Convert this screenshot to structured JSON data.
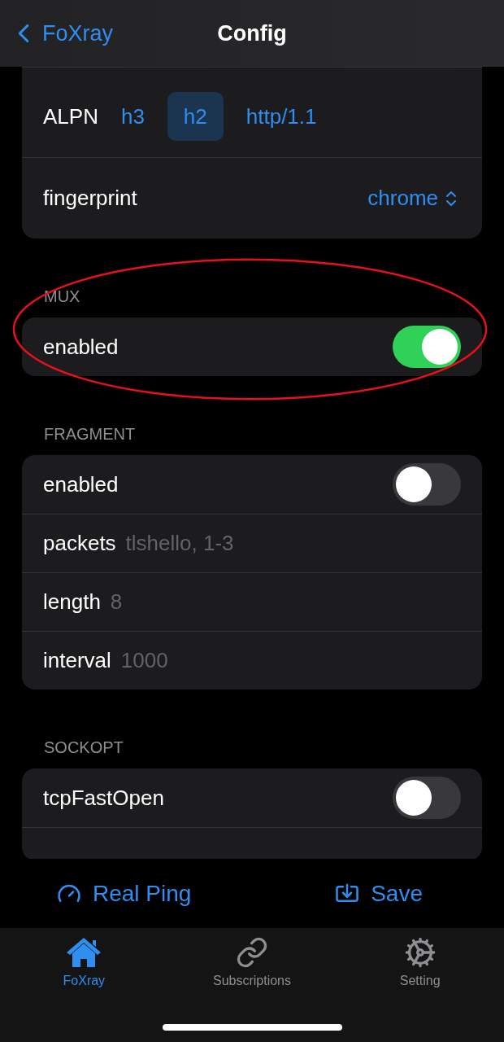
{
  "nav": {
    "back_label": "FoXray",
    "title": "Config"
  },
  "sections": [
    {
      "rows": [
        {
          "kind": "segmented",
          "label": "ALPN",
          "options": [
            {
              "label": "h3",
              "selected": false
            },
            {
              "label": "h2",
              "selected": true
            },
            {
              "label": "http/1.1",
              "selected": false
            }
          ]
        },
        {
          "kind": "picker",
          "label": "fingerprint",
          "value": "chrome"
        }
      ]
    },
    {
      "header": "MUX",
      "highlighted": true,
      "rows": [
        {
          "kind": "toggle",
          "label": "enabled",
          "on": true
        }
      ]
    },
    {
      "header": "FRAGMENT",
      "highlighted": false,
      "rows": [
        {
          "kind": "toggle",
          "label": "enabled",
          "on": false
        },
        {
          "kind": "field",
          "label": "packets",
          "placeholder": "tlshello, 1-3"
        },
        {
          "kind": "field",
          "label": "length",
          "placeholder": "8"
        },
        {
          "kind": "field",
          "label": "interval",
          "placeholder": "1000"
        }
      ]
    },
    {
      "header": "SOCKOPT",
      "highlighted": false,
      "rows": [
        {
          "kind": "toggle",
          "label": "tcpFastOpen",
          "on": false
        }
      ]
    }
  ],
  "toolbar": [
    {
      "label": "Real Ping"
    },
    {
      "label": "Save"
    }
  ],
  "tabs": [
    {
      "label": "FoXray",
      "selected": true
    },
    {
      "label": "Subscriptions",
      "selected": false
    },
    {
      "label": "Setting",
      "selected": false
    }
  ]
}
